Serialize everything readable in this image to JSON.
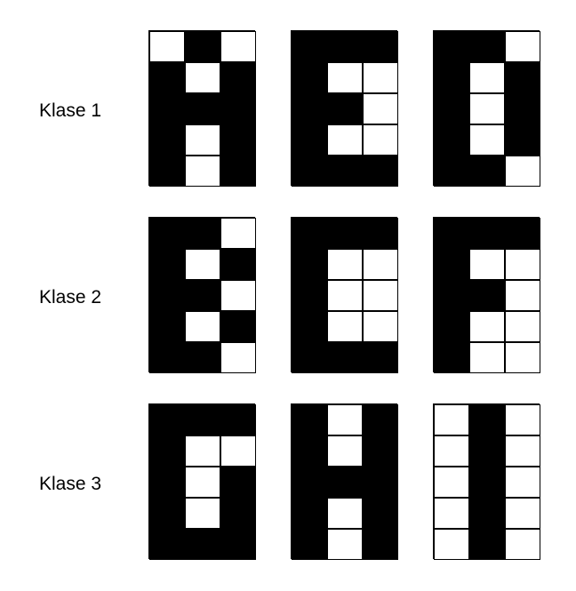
{
  "rows": [
    {
      "label": "Klase 1",
      "glyphs": [
        {
          "name": "A",
          "pattern": [
            "WBW",
            "BWB",
            "BBB",
            "BWB",
            "BWB"
          ]
        },
        {
          "name": "B",
          "pattern": [
            "BBB",
            "BWW",
            "BBW",
            "BWW",
            "BBB"
          ]
        },
        {
          "name": "D",
          "pattern": [
            "BBW",
            "BWB",
            "BWB",
            "BWB",
            "BBW"
          ]
        }
      ]
    },
    {
      "label": "Klase 2",
      "glyphs": [
        {
          "name": "E",
          "pattern": [
            "BBW",
            "BWB",
            "BBW",
            "BWB",
            "BBW"
          ]
        },
        {
          "name": "C",
          "pattern": [
            "BBB",
            "BWW",
            "BWW",
            "BWW",
            "BBB"
          ]
        },
        {
          "name": "F",
          "pattern": [
            "BBB",
            "BWW",
            "BBW",
            "BWW",
            "BWW"
          ]
        }
      ]
    },
    {
      "label": "Klase 3",
      "glyphs": [
        {
          "name": "G",
          "pattern": [
            "BBB",
            "BWW",
            "BWB",
            "BWB",
            "BBB"
          ]
        },
        {
          "name": "H",
          "pattern": [
            "BWB",
            "BWB",
            "BBB",
            "BWB",
            "BWB"
          ]
        },
        {
          "name": "I",
          "pattern": [
            "WBW",
            "WBW",
            "WBW",
            "WBW",
            "WBW"
          ]
        }
      ]
    }
  ],
  "colors": {
    "filled": "#000000",
    "empty": "#ffffff"
  }
}
